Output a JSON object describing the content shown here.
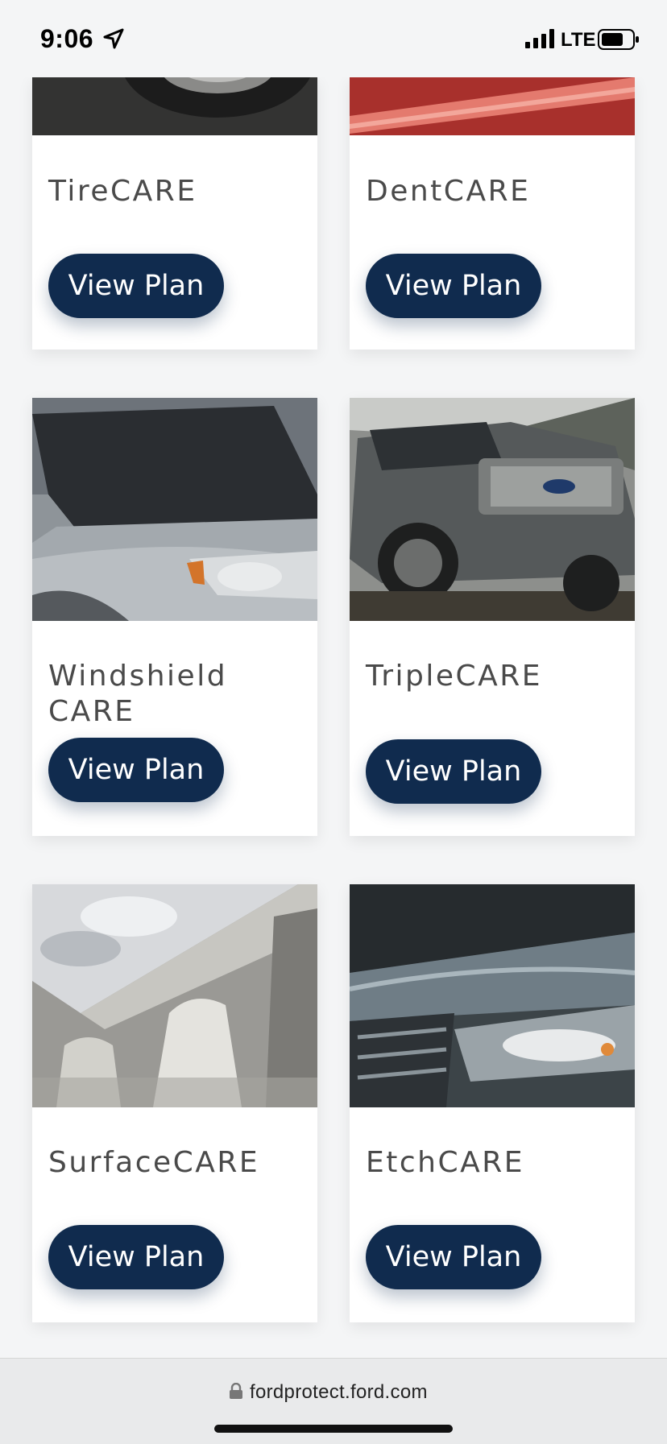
{
  "status_bar": {
    "time": "9:06",
    "network": "LTE"
  },
  "cards": [
    {
      "title": "TireCARE",
      "button": "View Plan"
    },
    {
      "title": "DentCARE",
      "button": "View Plan"
    },
    {
      "title": "Windshield CARE",
      "button": "View Plan"
    },
    {
      "title": "TripleCARE",
      "button": "View Plan"
    },
    {
      "title": "SurfaceCARE",
      "button": "View Plan"
    },
    {
      "title": "EtchCARE",
      "button": "View Plan"
    }
  ],
  "browser": {
    "url": "fordprotect.ford.com"
  },
  "colors": {
    "button_bg": "#102b4e",
    "page_bg": "#f4f5f6"
  },
  "icons": [
    "location-arrow-icon",
    "signal-icon",
    "battery-icon",
    "lock-icon"
  ]
}
